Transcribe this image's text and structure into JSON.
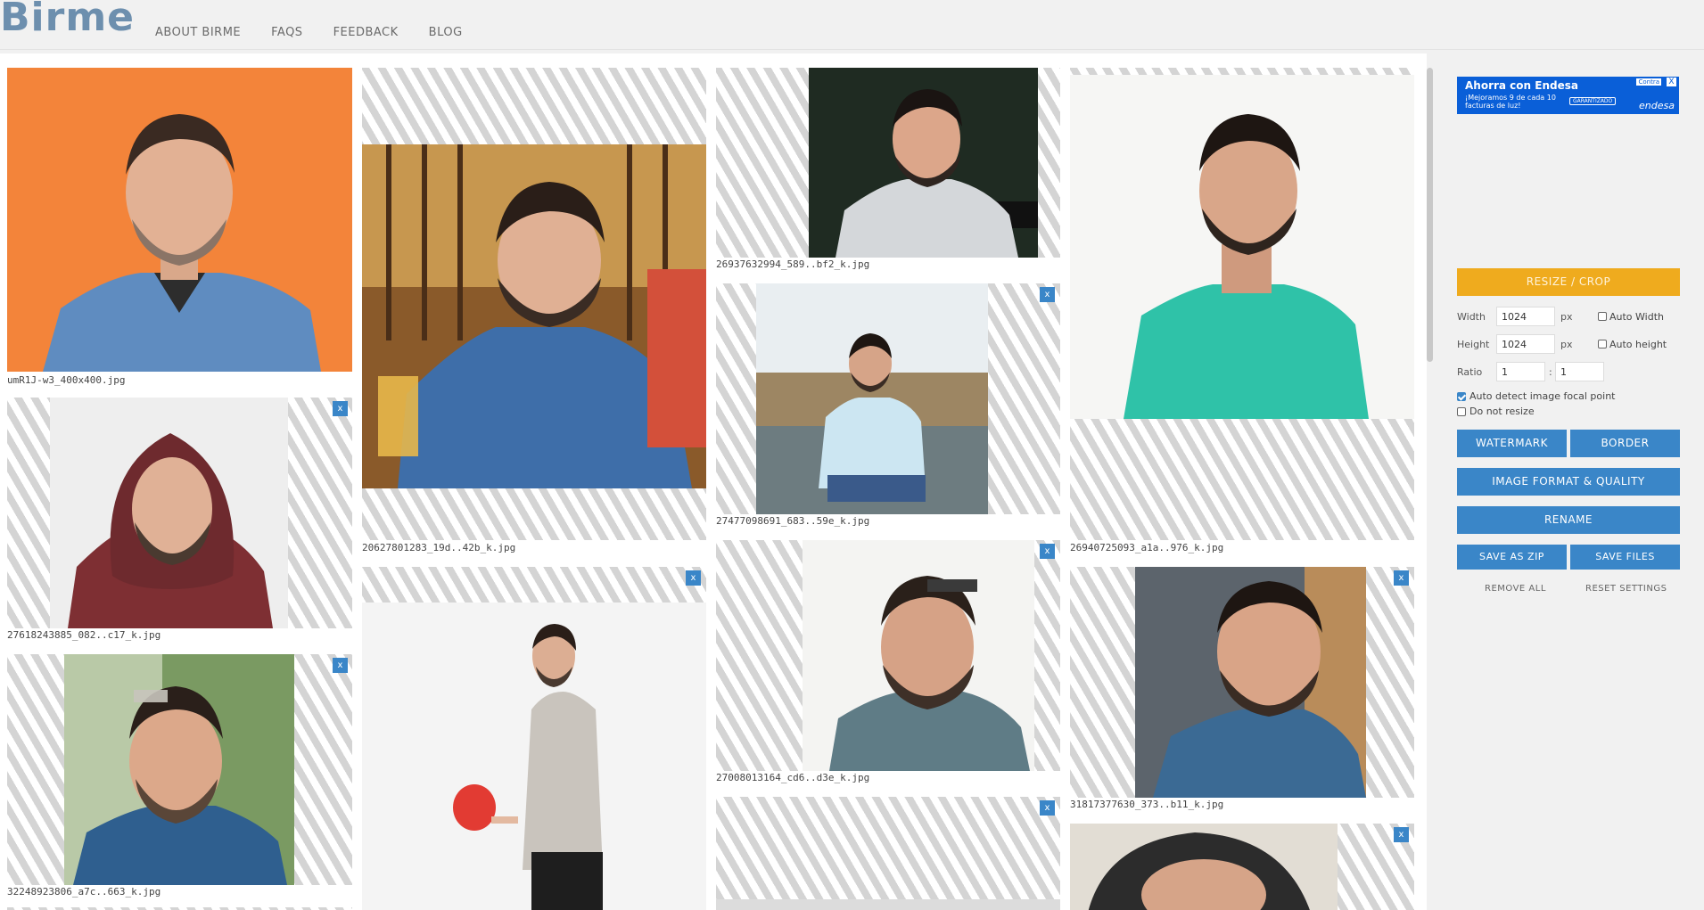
{
  "app": {
    "logo_text": "Birme",
    "nav": [
      "ABOUT BIRME",
      "FAQS",
      "FEEDBACK",
      "BLOG"
    ]
  },
  "gallery": {
    "close_label": "x",
    "images": [
      {
        "filename": "umR1J-w3_400x400.jpg",
        "background": "#f3843a",
        "shirt": "#5f8cc0",
        "crop": "full"
      },
      {
        "filename": "20627801283_19d..42b_k.jpg",
        "background": "#b9894a",
        "shirt": "#3e6ea9",
        "crop": "band-vertical"
      },
      {
        "filename": "26937632994_589..bf2_k.jpg",
        "background": "#1e2a20",
        "shirt": "#d4d7da",
        "crop": "band-horizontal"
      },
      {
        "filename": "26940725093_a1a..976_k.jpg",
        "background": "#f4f4f2",
        "shirt": "#2fc2a8",
        "crop": "top-band"
      },
      {
        "filename": "27618243885_082..c17_k.jpg",
        "background": "#eeeeee",
        "shirt": "#7e2f33",
        "crop": "band-horizontal"
      },
      {
        "filename": "27477098691_683..59e_k.jpg",
        "background": "#8fa8b4",
        "shirt": "#cce6f2",
        "crop": "band-horizontal"
      },
      {
        "filename": "27008013164_cd6..d3e_k.jpg",
        "background": "#f3f3f1",
        "shirt": "#5f7c86",
        "crop": "band-horizontal"
      },
      {
        "filename": "31817377630_373..b11_k.jpg",
        "background": "#4c5660",
        "shirt": "#3b6a94",
        "crop": "band-horizontal"
      },
      {
        "filename": "32248923806_a7c..663_k.jpg",
        "background": "#5a7a4a",
        "shirt": "#2f5f8f",
        "crop": "band-horizontal"
      },
      {
        "filename": "",
        "background": "#f2f2f2",
        "shirt": "#c9c4bd",
        "crop": "partial"
      },
      {
        "filename": "",
        "background": "#dcdcdc",
        "shirt": "#cfcfcf",
        "crop": "partial"
      },
      {
        "filename": "",
        "background": "#d8d2c8",
        "shirt": "#2c2c2c",
        "crop": "partial"
      }
    ]
  },
  "sidebar": {
    "ad": {
      "title": "Ahorra con Endesa",
      "subtitle": "¡Mejoramos 9 de cada 10 facturas de luz!",
      "badge": "Contra",
      "button": "GARANTIZADO",
      "brand": "endesa",
      "close": "X",
      "color": "#0a5fd8"
    },
    "resize_crop": "RESIZE / CROP",
    "width_label": "Width",
    "width_value": "1024",
    "height_label": "Height",
    "height_value": "1024",
    "px_unit": "px",
    "auto_width_label": "Auto Width",
    "auto_height_label": "Auto height",
    "ratio_label": "Ratio",
    "ratio_a": "1",
    "ratio_b": "1",
    "ratio_sep": ":",
    "auto_detect_label": "Auto detect image focal point",
    "do_not_resize_label": "Do not resize",
    "watermark": "WATERMARK",
    "border": "BORDER",
    "image_format": "IMAGE FORMAT & QUALITY",
    "rename": "RENAME",
    "save_zip": "SAVE AS ZIP",
    "save_files": "SAVE FILES",
    "remove_all": "REMOVE ALL",
    "reset_settings": "RESET SETTINGS"
  },
  "colors": {
    "accent_blue": "#3a86c8",
    "accent_orange": "#efab1e",
    "logo": "#6d8fae"
  }
}
